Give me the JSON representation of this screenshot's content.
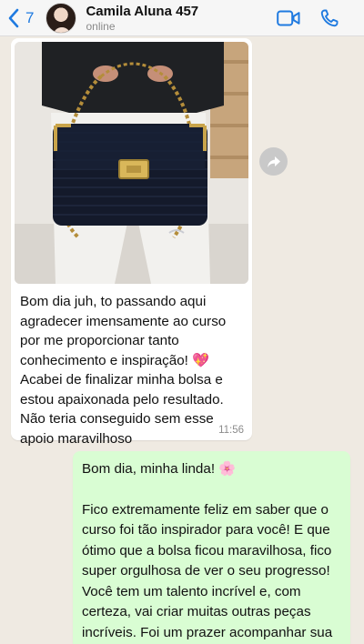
{
  "header": {
    "back_count": "7",
    "contact_name": "Camila Aluna 457",
    "contact_status": "online",
    "icons": [
      "chevron-left-icon",
      "video-call-icon",
      "phone-icon"
    ],
    "accent_color": "#1f7ae0"
  },
  "messages": {
    "incoming": {
      "image_description_icon": "black-crochet-handbag-photo",
      "text": "Bom dia juh, to passando aqui agradecer imensamente ao curso por me proporcionar tanto conhecimento e inspiração! ",
      "emoji": "💖",
      "text_after_emoji": " Acabei de finalizar minha bolsa e estou apaixonada pelo resultado. Não teria conseguido sem esse apoio maravilhoso",
      "time": "11:56"
    },
    "outgoing": {
      "greeting": "Bom dia, minha linda! ",
      "greeting_emoji": "🌸",
      "text": "Fico extremamente feliz em saber que o curso foi tão inspirador para você! E que ótimo que a bolsa ficou maravilhosa, fico super orgulhosa de ver o seu progresso! Você tem um talento incrível e, com certeza, vai criar muitas outras peças incríveis. Foi um prazer acompanhar sua jornada e"
    }
  },
  "colors": {
    "chat_background": "#efeae2",
    "incoming_bubble": "#ffffff",
    "outgoing_bubble": "#d9fdd3"
  }
}
